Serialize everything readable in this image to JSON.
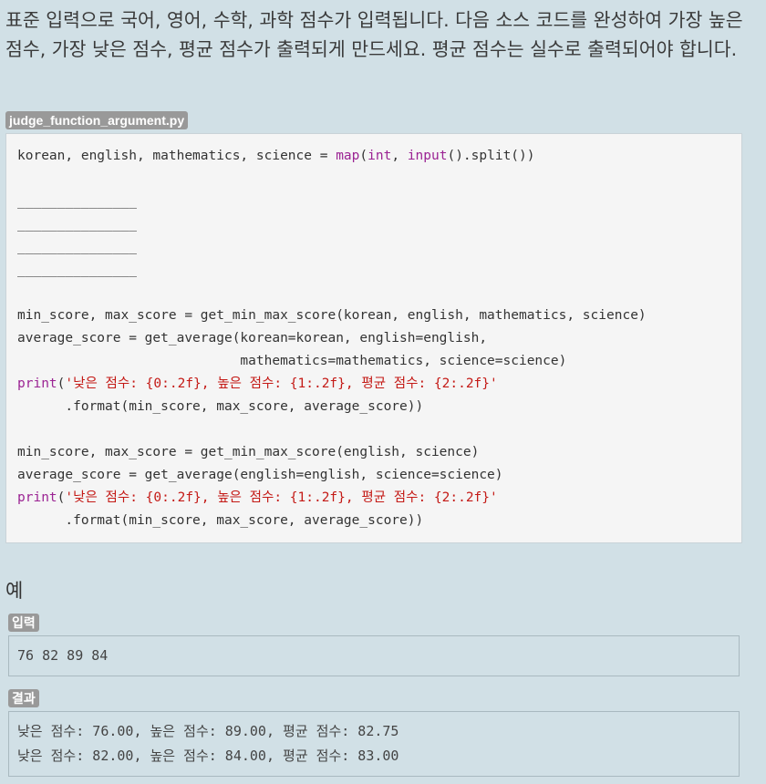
{
  "problem": {
    "text": "표준 입력으로 국어, 영어, 수학, 과학 점수가 입력됩니다. 다음 소스 코드를 완성하여 가장 높은 점수, 가장 낮은 점수, 평균 점수가 출력되게 만드세요. 평균 점수는 실수로 출력되어야 합니다."
  },
  "code": {
    "filename": "judge_function_argument.py",
    "line1": {
      "a": "korean, english, mathematics, science = ",
      "b": "map",
      "c": "(",
      "d": "int",
      "e": ", ",
      "f": "input",
      "g": "().split())"
    },
    "blanks": [
      "_______________",
      "_______________",
      "_______________",
      "_______________"
    ],
    "block1": {
      "line1": "min_score, max_score = get_min_max_score(korean, english, mathematics, science)",
      "line2": "average_score = get_average(korean=korean, english=english,",
      "line3": "                            mathematics=mathematics, science=science)",
      "print_kw": "print",
      "print_open": "(",
      "print_str": "'낮은 점수: {0:.2f}, 높은 점수: {1:.2f}, 평균 점수: {2:.2f}'",
      "format_line": "      .format(min_score, max_score, average_score))"
    },
    "block2": {
      "line1": "min_score, max_score = get_min_max_score(english, science)",
      "line2": "average_score = get_average(english=english, science=science)",
      "print_kw": "print",
      "print_open": "(",
      "print_str": "'낮은 점수: {0:.2f}, 높은 점수: {1:.2f}, 평균 점수: {2:.2f}'",
      "format_line": "      .format(min_score, max_score, average_score))"
    }
  },
  "example": {
    "title": "예",
    "input_label": "입력",
    "input_value": "76 82 89 84",
    "result_label": "결과",
    "result_lines": [
      "낮은 점수: 76.00, 높은 점수: 89.00, 평균 점수: 82.75",
      "낮은 점수: 82.00, 높은 점수: 84.00, 평균 점수: 83.00"
    ]
  },
  "colors": {
    "background": "#d1e0e6",
    "code_background": "#f5f5f5",
    "label_badge": "#999999",
    "keyword": "#9b2393",
    "string": "#c41a16"
  }
}
